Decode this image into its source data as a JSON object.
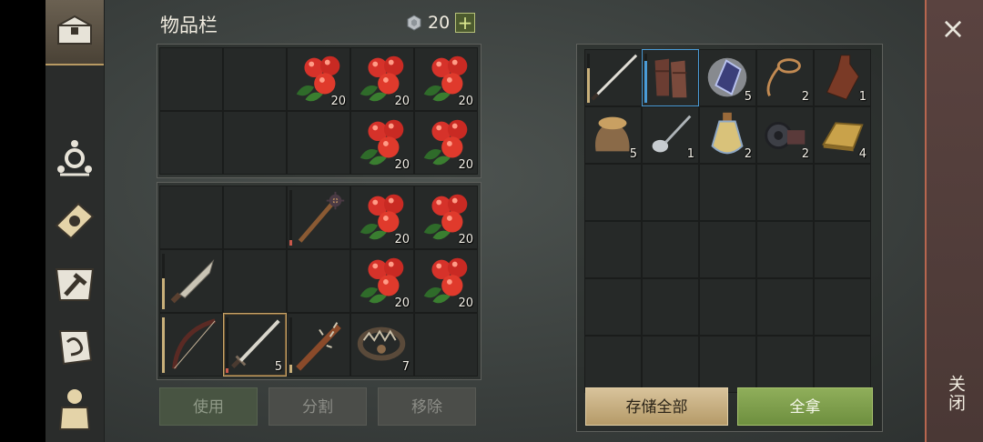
{
  "inventory": {
    "title": "物品栏",
    "coins": "20",
    "add_symbol": "+",
    "upper_rows": [
      [
        {
          "item": "empty",
          "count": ""
        },
        {
          "item": "empty",
          "count": ""
        },
        {
          "item": "berries",
          "count": "20"
        },
        {
          "item": "berries",
          "count": "20"
        },
        {
          "item": "berries",
          "count": "20"
        }
      ],
      [
        {
          "item": "empty",
          "count": ""
        },
        {
          "item": "empty",
          "count": ""
        },
        {
          "item": "empty",
          "count": ""
        },
        {
          "item": "berries",
          "count": "20"
        },
        {
          "item": "berries",
          "count": "20"
        }
      ]
    ],
    "lower_rows": [
      [
        {
          "item": "empty",
          "count": ""
        },
        {
          "item": "empty",
          "count": ""
        },
        {
          "item": "spiked-mace",
          "count": "",
          "durability": 0.1
        },
        {
          "item": "berries",
          "count": "20"
        },
        {
          "item": "berries",
          "count": "20"
        }
      ],
      [
        {
          "item": "machete",
          "count": "",
          "durability": 0.55
        },
        {
          "item": "empty",
          "count": ""
        },
        {
          "item": "empty",
          "count": ""
        },
        {
          "item": "berries",
          "count": "20"
        },
        {
          "item": "berries",
          "count": "20"
        }
      ],
      [
        {
          "item": "bow",
          "count": "",
          "durability": 1.0
        },
        {
          "item": "sword",
          "count": "5",
          "durability": 0.08,
          "selected": true,
          "count_icon": "arrow-icon"
        },
        {
          "item": "spiked-club",
          "count": "",
          "durability": 0.15
        },
        {
          "item": "bear-trap",
          "count": "7"
        },
        {
          "item": "empty",
          "count": ""
        }
      ]
    ],
    "buttons": {
      "use": "使用",
      "split": "分割",
      "remove": "移除"
    }
  },
  "storage": {
    "rows": [
      [
        {
          "item": "long-sword",
          "count": "",
          "durability": 0.7
        },
        {
          "item": "leather-gloves",
          "count": "",
          "durability": 0.85,
          "highlight": true
        },
        {
          "item": "crystal",
          "count": "5"
        },
        {
          "item": "rope",
          "count": "2"
        },
        {
          "item": "bottle",
          "count": "1"
        }
      ],
      [
        {
          "item": "grain-sack",
          "count": "5"
        },
        {
          "item": "spoon",
          "count": "1"
        },
        {
          "item": "potion",
          "count": "2"
        },
        {
          "item": "gear-parts",
          "count": "2"
        },
        {
          "item": "gold-bar",
          "count": "4"
        }
      ],
      [
        {
          "item": "empty",
          "count": ""
        },
        {
          "item": "empty",
          "count": ""
        },
        {
          "item": "empty",
          "count": ""
        },
        {
          "item": "empty",
          "count": ""
        },
        {
          "item": "empty",
          "count": ""
        }
      ],
      [
        {
          "item": "empty",
          "count": ""
        },
        {
          "item": "empty",
          "count": ""
        },
        {
          "item": "empty",
          "count": ""
        },
        {
          "item": "empty",
          "count": ""
        },
        {
          "item": "empty",
          "count": ""
        }
      ],
      [
        {
          "item": "empty",
          "count": ""
        },
        {
          "item": "empty",
          "count": ""
        },
        {
          "item": "empty",
          "count": ""
        },
        {
          "item": "empty",
          "count": ""
        },
        {
          "item": "empty",
          "count": ""
        }
      ],
      [
        {
          "item": "empty",
          "count": ""
        },
        {
          "item": "empty",
          "count": ""
        },
        {
          "item": "empty",
          "count": ""
        },
        {
          "item": "empty",
          "count": ""
        },
        {
          "item": "empty",
          "count": ""
        }
      ]
    ],
    "buttons": {
      "store_all": "存储全部",
      "take_all": "全拿"
    }
  },
  "sidebar": {
    "icons": [
      "chest-icon",
      "skills-icon",
      "recipes-book-icon",
      "build-hammer-icon",
      "map-scroll-icon",
      "backpack-icon"
    ]
  },
  "close": {
    "symbol": "×",
    "label": "关闭"
  }
}
